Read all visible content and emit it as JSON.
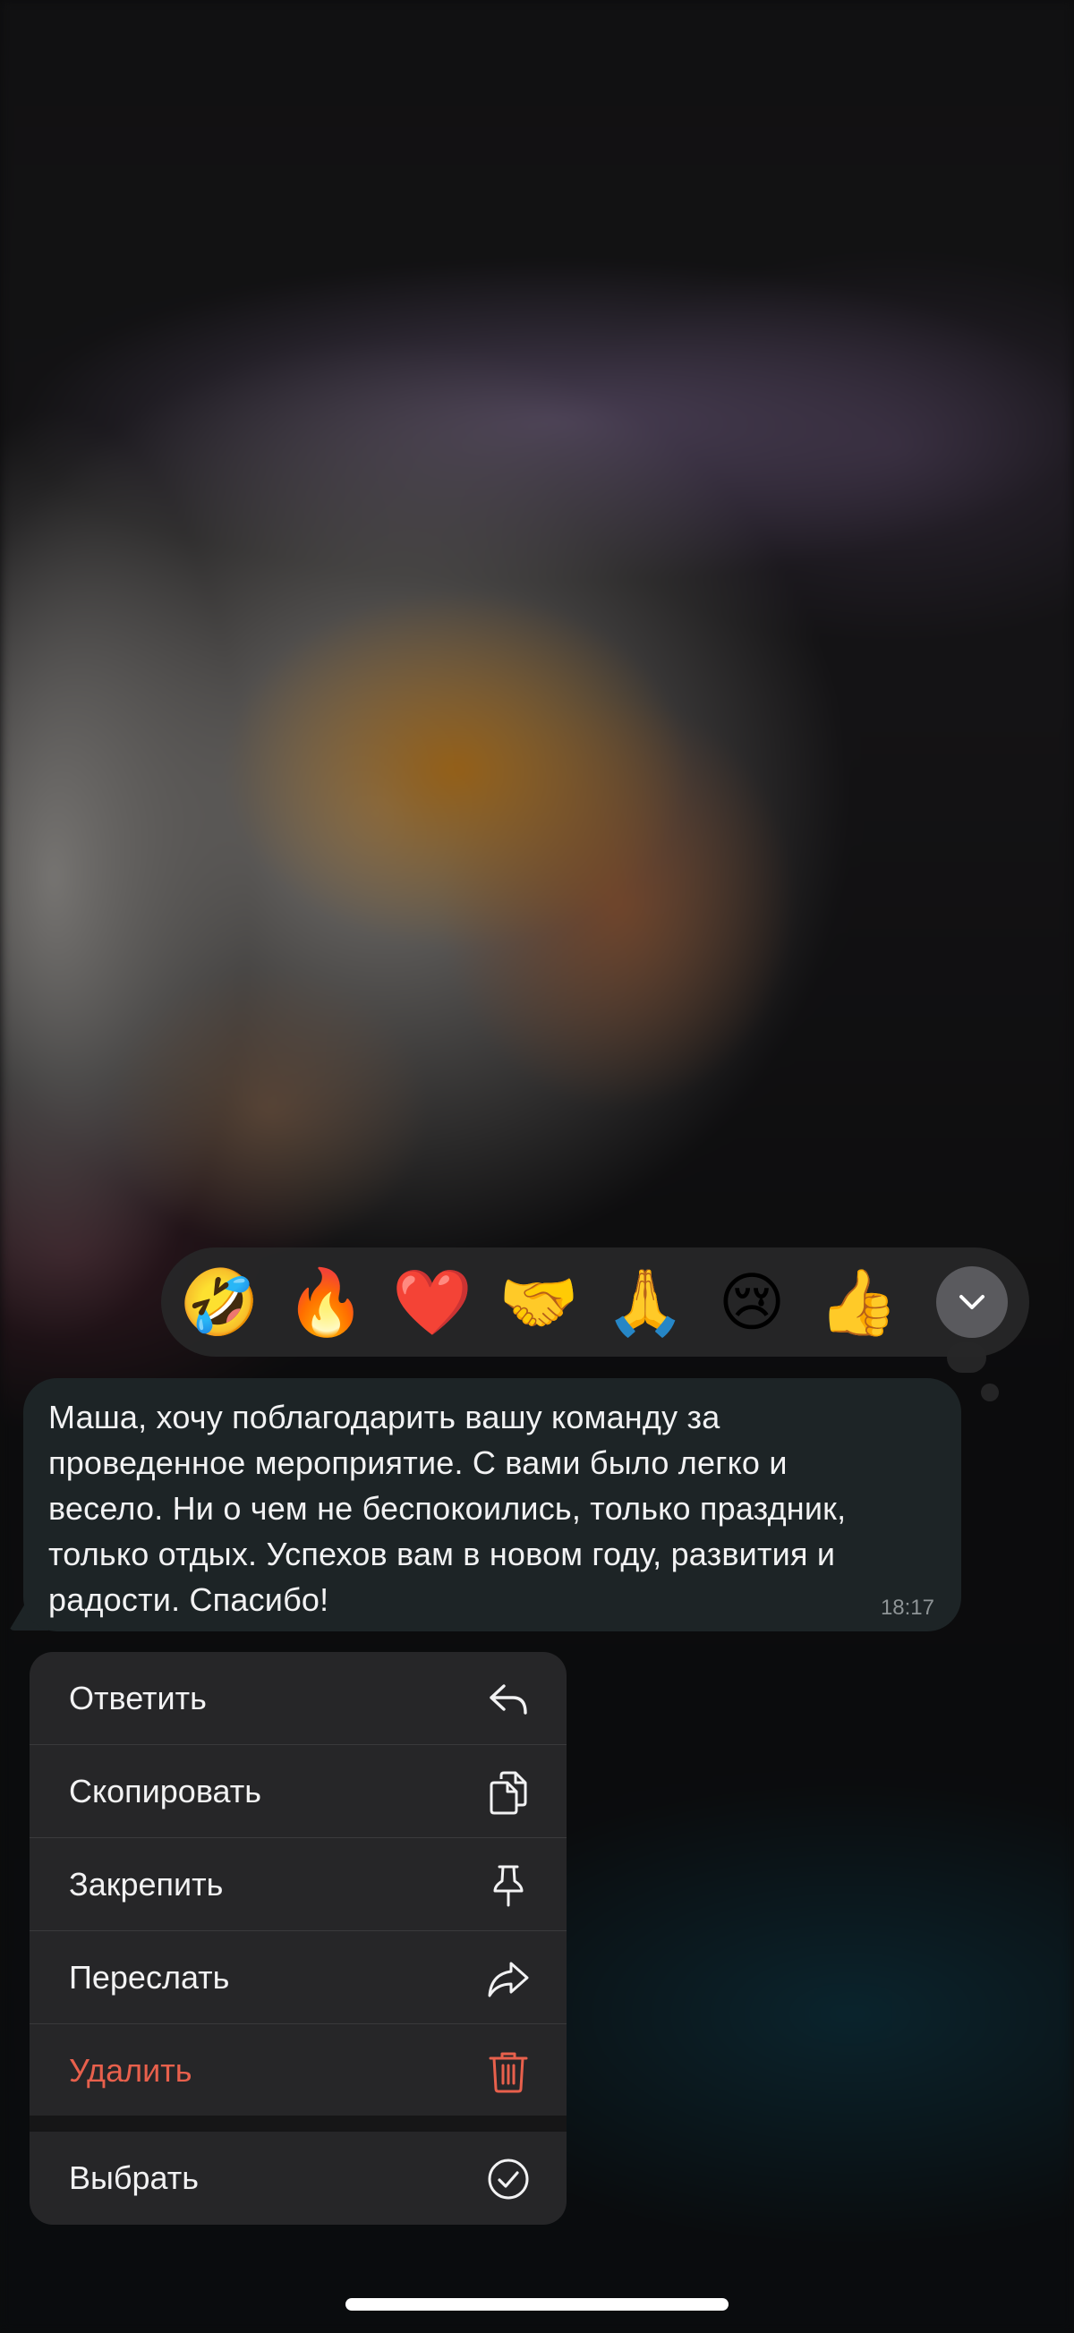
{
  "reactions": [
    {
      "emoji": "🤣",
      "icon": "rolling-laughing-emoji"
    },
    {
      "emoji": "🔥",
      "icon": "fire-emoji"
    },
    {
      "emoji": "❤️",
      "icon": "red-heart-emoji"
    },
    {
      "emoji": "🤝",
      "icon": "handshake-emoji"
    },
    {
      "emoji": "🙏",
      "icon": "folded-hands-emoji"
    },
    {
      "emoji": "😢",
      "icon": "crying-face-emoji"
    },
    {
      "emoji": "👍",
      "icon": "thumbs-up-emoji"
    }
  ],
  "reactions_more_icon": "chevron-down-icon",
  "message": {
    "lines": [
      "Маша, хочу поблагодарить вашу команду за",
      "проведенное мероприятие. С вами было легко и",
      "весело. Ни о чем не беспокоились, только праздник,",
      "только отдых. Успехов вам в новом году, развития и",
      "радости. Спасибо!"
    ],
    "time": "18:17"
  },
  "menu": {
    "items": [
      {
        "label": "Ответить",
        "icon": "reply-icon"
      },
      {
        "label": "Скопировать",
        "icon": "copy-icon"
      },
      {
        "label": "Закрепить",
        "icon": "pin-icon"
      },
      {
        "label": "Переслать",
        "icon": "forward-icon"
      },
      {
        "label": "Удалить",
        "icon": "trash-icon"
      },
      {
        "label": "Выбрать",
        "icon": "checkmark-circle-icon"
      }
    ]
  },
  "colors": {
    "danger": "#e8604c",
    "bubble": "#1d2426",
    "menu_bg": "#262628"
  }
}
